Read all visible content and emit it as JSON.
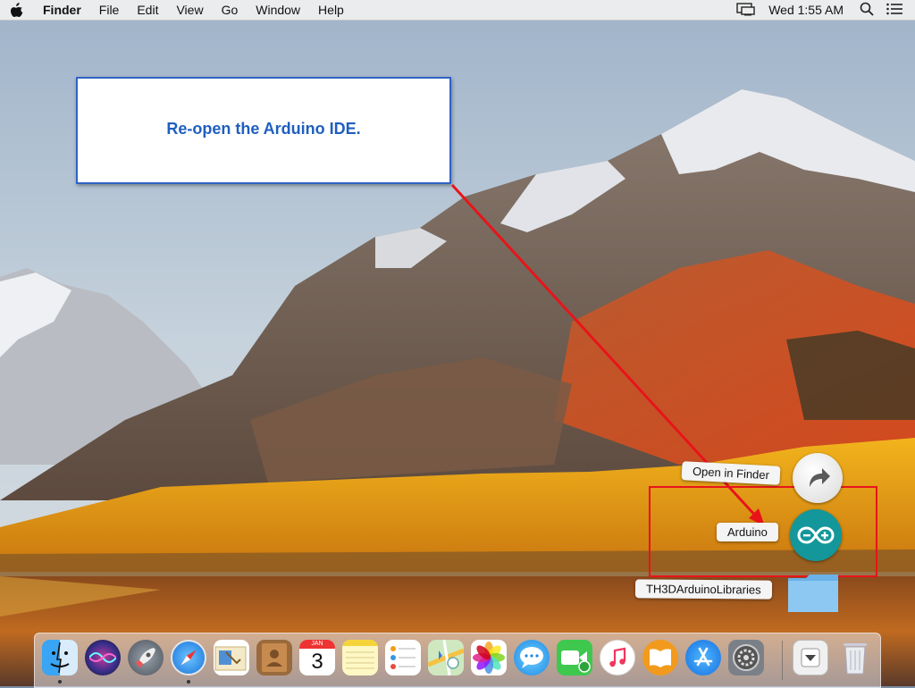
{
  "menubar": {
    "apple_icon": "apple-icon",
    "app_name": "Finder",
    "menus": [
      "File",
      "Edit",
      "View",
      "Go",
      "Window",
      "Help"
    ],
    "clock": "Wed 1:55 AM",
    "status_icons": [
      "display-mirroring-icon",
      "spotlight-search-icon",
      "notification-center-icon"
    ]
  },
  "callout": {
    "text": "Re-open the Arduino IDE.",
    "border_color": "#2f63c6",
    "text_color": "#1f5fbf"
  },
  "annotation": {
    "arrow_color": "#e8141a",
    "highlight_color": "#e8141a"
  },
  "stack_popup": {
    "items": [
      {
        "label": "Open in Finder",
        "icon": "open-in-finder-arrow-icon"
      },
      {
        "label": "Arduino",
        "icon": "arduino-app-icon"
      },
      {
        "label": "TH3DArduinoLibraries",
        "icon": "folder-icon"
      }
    ]
  },
  "dock": {
    "apps": [
      {
        "name": "Finder",
        "icon": "finder-icon",
        "running": true
      },
      {
        "name": "Siri",
        "icon": "siri-icon",
        "running": false
      },
      {
        "name": "Launchpad",
        "icon": "launchpad-icon",
        "running": false
      },
      {
        "name": "Safari",
        "icon": "safari-icon",
        "running": true
      },
      {
        "name": "Mail",
        "icon": "mail-icon",
        "running": false
      },
      {
        "name": "Contacts",
        "icon": "contacts-icon",
        "running": false
      },
      {
        "name": "Calendar",
        "icon": "calendar-icon",
        "running": false,
        "month": "JAN",
        "day": "3"
      },
      {
        "name": "Notes",
        "icon": "notes-icon",
        "running": false
      },
      {
        "name": "Reminders",
        "icon": "reminders-icon",
        "running": false
      },
      {
        "name": "Maps",
        "icon": "maps-icon",
        "running": false
      },
      {
        "name": "Photos",
        "icon": "photos-icon",
        "running": false
      },
      {
        "name": "Messages",
        "icon": "messages-icon",
        "running": false
      },
      {
        "name": "FaceTime",
        "icon": "facetime-icon",
        "running": false
      },
      {
        "name": "iTunes",
        "icon": "itunes-icon",
        "running": false
      },
      {
        "name": "iBooks",
        "icon": "ibooks-icon",
        "running": false
      },
      {
        "name": "App Store",
        "icon": "app-store-icon",
        "running": false
      },
      {
        "name": "System Preferences",
        "icon": "system-preferences-icon",
        "running": false
      }
    ],
    "stack": {
      "name": "Downloads stack",
      "icon": "stack-chevron-icon"
    },
    "trash": {
      "name": "Trash",
      "icon": "trash-icon"
    }
  }
}
